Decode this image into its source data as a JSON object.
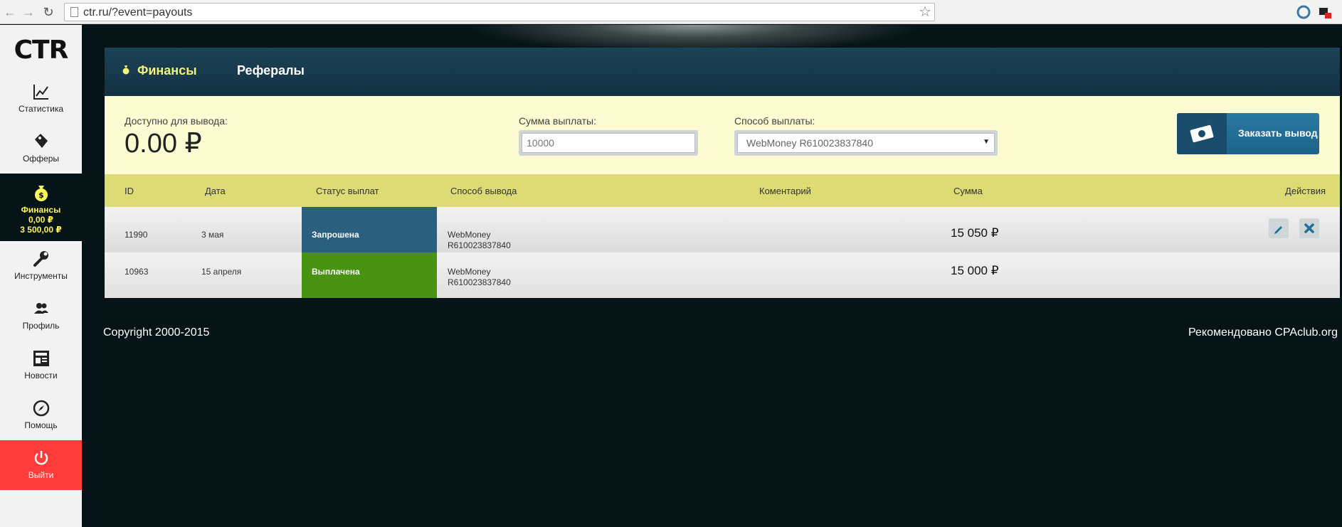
{
  "browser": {
    "url": "ctr.ru/?event=payouts",
    "back_icon": "back-arrow-icon",
    "forward_icon": "forward-arrow-icon",
    "reload_icon": "reload-icon"
  },
  "sidebar": {
    "logo": "CTR",
    "items": [
      {
        "label": "Статистика",
        "icon": "chart-icon"
      },
      {
        "label": "Офферы",
        "icon": "tag-icon"
      },
      {
        "label": "Финансы",
        "icon": "money-bag-icon",
        "balance": "0,00 ₽",
        "hold": "3 500,00 ₽"
      },
      {
        "label": "Инструменты",
        "icon": "wrench-icon"
      },
      {
        "label": "Профиль",
        "icon": "users-icon"
      },
      {
        "label": "Новости",
        "icon": "news-icon"
      },
      {
        "label": "Помощь",
        "icon": "compass-icon"
      },
      {
        "label": "Выйти",
        "icon": "power-icon"
      }
    ]
  },
  "tabs": [
    {
      "label": "Финансы",
      "active": true
    },
    {
      "label": "Рефералы",
      "active": false
    }
  ],
  "payout_form": {
    "available_label": "Доступно для вывода:",
    "available_value": "0.00 ₽",
    "amount_label": "Сумма выплаты:",
    "amount_value": "10000",
    "method_label": "Способ выплаты:",
    "method_value": "WebMoney R610023837840",
    "order_button": "Заказать вывод"
  },
  "table": {
    "headers": [
      "ID",
      "Дата",
      "Статус выплат",
      "Способ вывода",
      "Коментарий",
      "Сумма",
      "Действия"
    ],
    "rows": [
      {
        "id": "11990",
        "date": "3 мая",
        "status": "Запрошена",
        "method_line1": "WebMoney",
        "method_line2": "R610023837840",
        "comment": "",
        "amount": "15 050 ₽"
      },
      {
        "id": "10963",
        "date": "15 апреля",
        "status": "Выплачена",
        "method_line1": "WebMoney",
        "method_line2": "R610023837840",
        "comment": "",
        "amount": "15 000 ₽"
      }
    ]
  },
  "footer": {
    "copyright": "Copyright 2000-2015",
    "recommended": "Рекомендовано CPAclub.org"
  },
  "colors": {
    "accent_yellow": "#f2f37a",
    "status_requested": "#2a607d",
    "status_paid": "#4a9212",
    "logout": "#ff3b3b"
  }
}
